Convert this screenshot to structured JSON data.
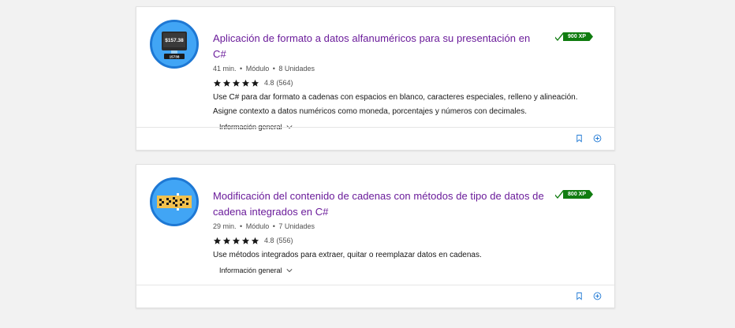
{
  "cards": [
    {
      "title": "Aplicación de formato a datos alfanuméricos para su presentación en C#",
      "duration": "41 min.",
      "type": "Módulo",
      "units": "8 Unidades",
      "rating": "4.8",
      "rating_count": "(564)",
      "stars": 5,
      "description": "Use C# para dar formato a cadenas con espacios en blanco, caracteres especiales, relleno y alineación. Asigne contexto a datos numéricos como moneda, porcentajes y números con decimales.",
      "overview_label": "Información general",
      "xp": "900 XP",
      "icon": "monitor-price-icon",
      "icon_text_top": "$157.38",
      "icon_text_bottom": "15738"
    },
    {
      "title": "Modificación del contenido de cadenas con métodos de tipo de datos de cadena integrados en C#",
      "duration": "29 min.",
      "type": "Módulo",
      "units": "7 Unidades",
      "rating": "4.8",
      "rating_count": "(556)",
      "stars": 5,
      "description": "Use métodos integrados para extraer, quitar o reemplazar datos en cadenas.",
      "overview_label": "Información general",
      "xp": "800 XP",
      "icon": "string-blocks-icon"
    }
  ],
  "colors": {
    "title": "#6a1b9a",
    "xp_badge": "#107c10",
    "icon_blue": "#41a5f5",
    "footer_icon": "#1e78d4"
  },
  "meta_separator": "•",
  "footer_icons": [
    "bookmark-icon",
    "add-circle-icon"
  ]
}
